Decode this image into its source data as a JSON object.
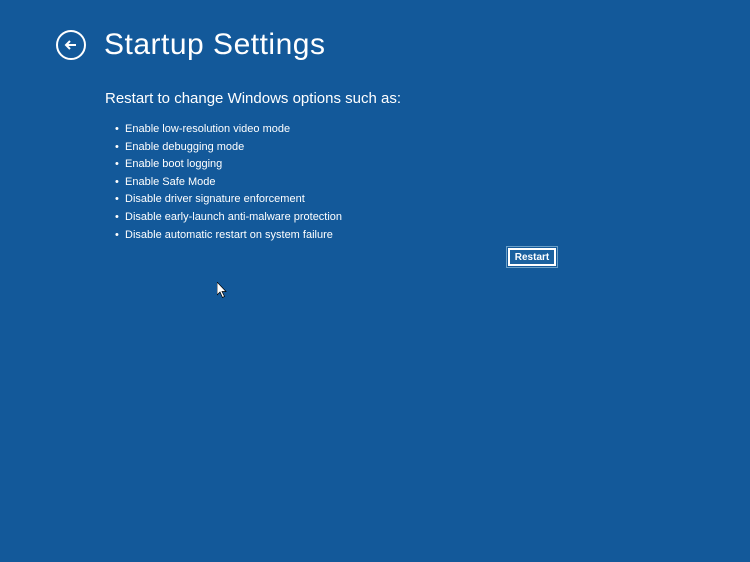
{
  "header": {
    "title": "Startup Settings"
  },
  "content": {
    "subtitle": "Restart to change Windows options such as:",
    "options": [
      "Enable low-resolution video mode",
      "Enable debugging mode",
      "Enable boot logging",
      "Enable Safe Mode",
      "Disable driver signature enforcement",
      "Disable early-launch anti-malware protection",
      "Disable automatic restart on system failure"
    ]
  },
  "buttons": {
    "restart": "Restart"
  }
}
